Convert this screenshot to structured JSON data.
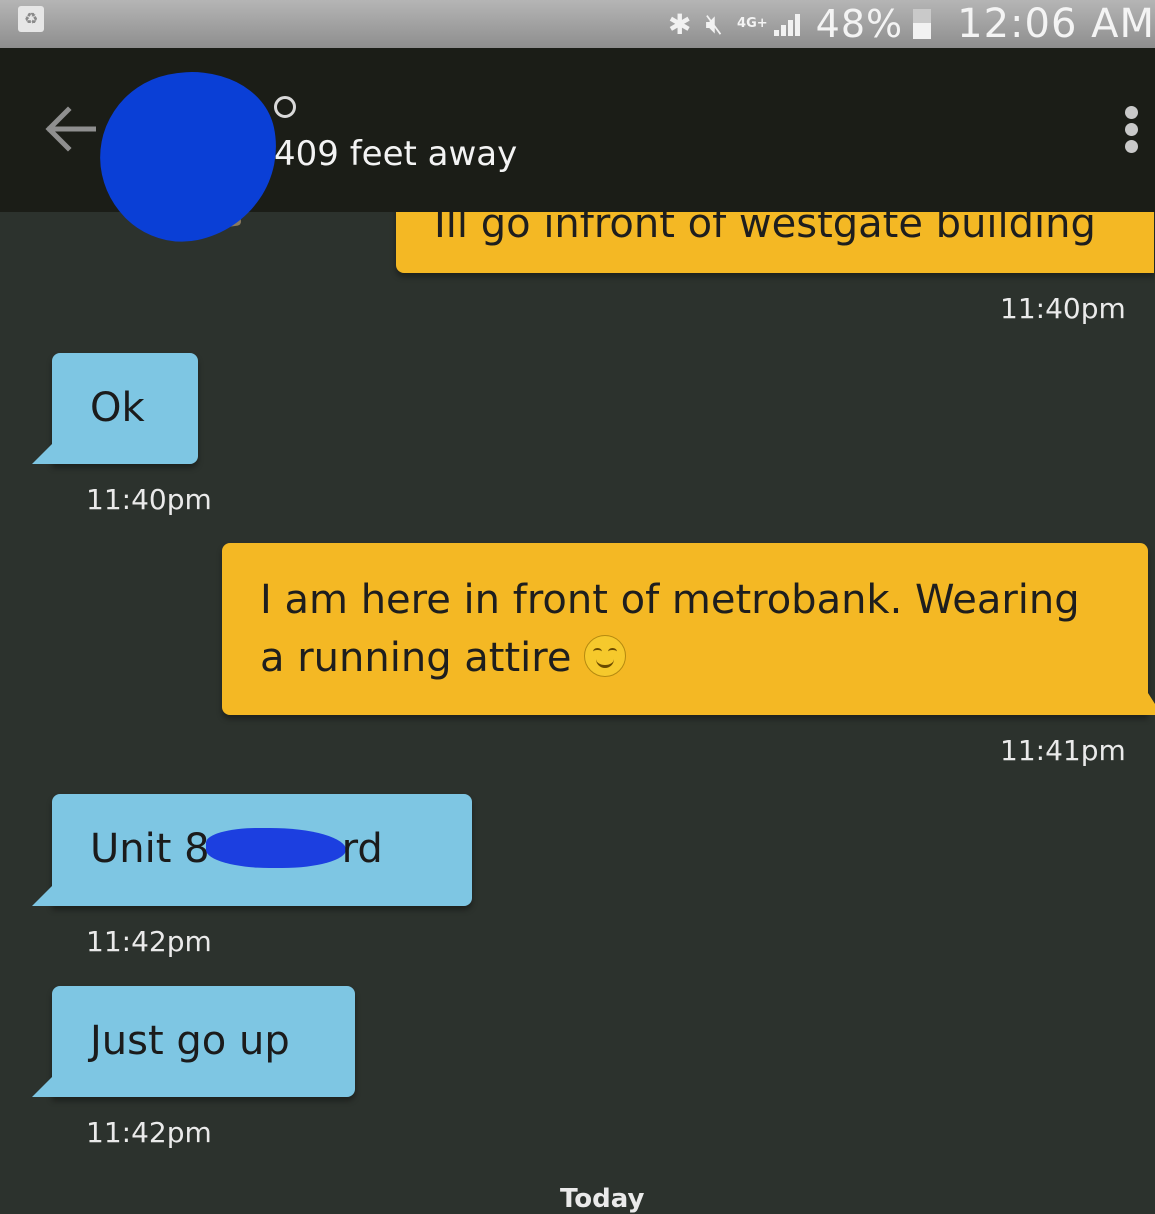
{
  "status_bar": {
    "network": "4G+",
    "battery": "48%",
    "clock": "12:06 AM"
  },
  "header": {
    "distance": "409 feet away"
  },
  "messages": [
    {
      "side": "sent",
      "text": "Ill go infront of westgate building",
      "time": "11:40pm"
    },
    {
      "side": "received",
      "text": "Ok",
      "time": "11:40pm"
    },
    {
      "side": "sent",
      "text_line1": "I am here in front of metrobank. Wearing",
      "text_line2": "a running attire",
      "emoji": "smiling-face-icon",
      "time": "11:41pm"
    },
    {
      "side": "received",
      "text_start": "Unit 8",
      "text_end": "rd",
      "time": "11:42pm"
    },
    {
      "side": "received",
      "text": "Just go up",
      "time": "11:42pm"
    }
  ],
  "divider": {
    "label": "Today"
  },
  "colors": {
    "sent_bubble": "#f4b824",
    "received_bubble": "#7ec6e3",
    "background": "#2c322d",
    "header": "#1b1d17",
    "redaction": "#0a3fd6"
  }
}
